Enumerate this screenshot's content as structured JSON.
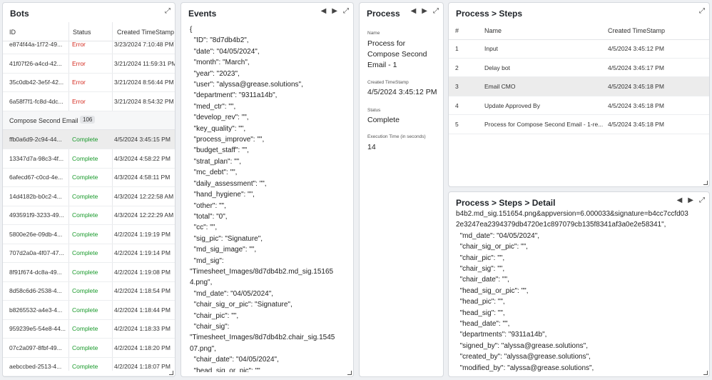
{
  "bots": {
    "title": "Bots",
    "columns": [
      "ID",
      "Status",
      "Created TimeStamp"
    ],
    "rows_top": [
      {
        "id": "e874f44a-1f72-49...",
        "status": "Error",
        "ts": "3/23/2024 7:10:48 PM"
      },
      {
        "id": "41f07f26-a4cd-42...",
        "status": "Error",
        "ts": "3/21/2024 11:59:31 PM"
      },
      {
        "id": "35c0db42-3e5f-42...",
        "status": "Error",
        "ts": "3/21/2024 8:56:44 PM"
      },
      {
        "id": "6a58f7f1-fc8d-4dc...",
        "status": "Error",
        "ts": "3/21/2024 8:54:32 PM"
      }
    ],
    "group": {
      "label": "Compose Second Email",
      "count": "106"
    },
    "rows_bottom": [
      {
        "id": "ffb0a6d9-2c94-44...",
        "status": "Complete",
        "ts": "4/5/2024 3:45:15 PM"
      },
      {
        "id": "13347d7a-98c3-4f...",
        "status": "Complete",
        "ts": "4/3/2024 4:58:22 PM"
      },
      {
        "id": "6afecd67-c0cd-4e...",
        "status": "Complete",
        "ts": "4/3/2024 4:58:11 PM"
      },
      {
        "id": "14d4182b-b0c2-4...",
        "status": "Complete",
        "ts": "4/3/2024 12:22:58 AM"
      },
      {
        "id": "493591f9-3233-49...",
        "status": "Complete",
        "ts": "4/3/2024 12:22:29 AM"
      },
      {
        "id": "5800e26e-09db-4...",
        "status": "Complete",
        "ts": "4/2/2024 1:19:19 PM"
      },
      {
        "id": "707d2a0a-4f07-47...",
        "status": "Complete",
        "ts": "4/2/2024 1:19:14 PM"
      },
      {
        "id": "8f91f674-dc8a-49...",
        "status": "Complete",
        "ts": "4/2/2024 1:19:08 PM"
      },
      {
        "id": "8d58c6d6-2538-4...",
        "status": "Complete",
        "ts": "4/2/2024 1:18:54 PM"
      },
      {
        "id": "b8265532-a4e3-4...",
        "status": "Complete",
        "ts": "4/2/2024 1:18:44 PM"
      },
      {
        "id": "959239e5-54e8-44...",
        "status": "Complete",
        "ts": "4/2/2024 1:18:33 PM"
      },
      {
        "id": "07c2a097-8fbf-49...",
        "status": "Complete",
        "ts": "4/2/2024 1:18:20 PM"
      },
      {
        "id": "aebccbed-2513-4...",
        "status": "Complete",
        "ts": "4/2/2024 1:18:07 PM"
      }
    ]
  },
  "events": {
    "title": "Events",
    "json_text": "{\n  \"ID\": \"8d7db4b2\",\n  \"date\": \"04/05/2024\",\n  \"month\": \"March\",\n  \"year\": \"2023\",\n  \"user\": \"alyssa@grease.solutions\",\n  \"department\": \"9311a14b\",\n  \"med_ctr\": \"\",\n  \"develop_rev\": \"\",\n  \"key_quality\": \"\",\n  \"process_improve\": \"\",\n  \"budget_staff\": \"\",\n  \"strat_plan\": \"\",\n  \"mc_debt\": \"\",\n  \"daily_assessment\": \"\",\n  \"hand_hygiene\": \"\",\n  \"other\": \"\",\n  \"total\": \"0\",\n  \"cc\": \"\",\n  \"sig_pic\": \"Signature\",\n  \"md_sig_image\": \"\",\n  \"md_sig\":\n\"Timesheet_Images/8d7db4b2.md_sig.15165\n4.png\",\n  \"md_date\": \"04/05/2024\",\n  \"chair_sig_or_pic\": \"Signature\",\n  \"chair_pic\": \"\",\n  \"chair_sig\":\n\"Timesheet_Images/8d7db4b2.chair_sig.1545\n07.png\",\n  \"chair_date\": \"04/05/2024\",\n  \"head_sig_or_pic\": \"\""
  },
  "process": {
    "title": "Process",
    "name_label": "Name",
    "name_value": "Process for Compose Second Email - 1",
    "created_label": "Created TimeStamp",
    "created_value": "4/5/2024 3:45:12 PM",
    "status_label": "Status",
    "status_value": "Complete",
    "exec_label": "Execution Time (in seconds)",
    "exec_value": "14"
  },
  "steps": {
    "title": "Process > Steps",
    "columns": [
      "#",
      "Name",
      "Created TimeStamp"
    ],
    "rows": [
      {
        "num": "1",
        "name": "Input",
        "ts": "4/5/2024 3:45:12 PM"
      },
      {
        "num": "2",
        "name": "Delay bot",
        "ts": "4/5/2024 3:45:17 PM"
      },
      {
        "num": "3",
        "name": "Email CMO",
        "ts": "4/5/2024 3:45:18 PM"
      },
      {
        "num": "4",
        "name": "Update Approved By",
        "ts": "4/5/2024 3:45:18 PM"
      },
      {
        "num": "5",
        "name": "Process for Compose Second Email - 1-re...",
        "ts": "4/5/2024 3:45:18 PM"
      }
    ]
  },
  "detail": {
    "title": "Process > Steps > Detail",
    "json_text": "b4b2.md_sig.151654.png&appversion=6.000033&signature=b4cc7ccfd03\n2e3247ea2394379db4720e1c897079cb135f8341af3a0e2e58341\",\n  \"md_date\": \"04/05/2024\",\n  \"chair_sig_or_pic\": \"\",\n  \"chair_pic\": \"\",\n  \"chair_sig\": \"\",\n  \"chair_date\": \"\",\n  \"head_sig_or_pic\": \"\",\n  \"head_pic\": \"\",\n  \"head_sig\": \"\",\n  \"head_date\": \"\",\n  \"departments\": \"9311a14b\",\n  \"signed_by\": \"alyssa@grease.solutions\",\n  \"created_by\": \"alyssa@grease.solutions\",\n  \"modified_by\": \"alyssa@grease.solutions\","
  },
  "colors": {
    "error": "#d42a1f",
    "complete": "#1a9a2c",
    "selected_row": "#ececec"
  },
  "icons": [
    "expand-icon",
    "prev-arrow-icon",
    "next-arrow-icon",
    "resize-handle-icon"
  ]
}
